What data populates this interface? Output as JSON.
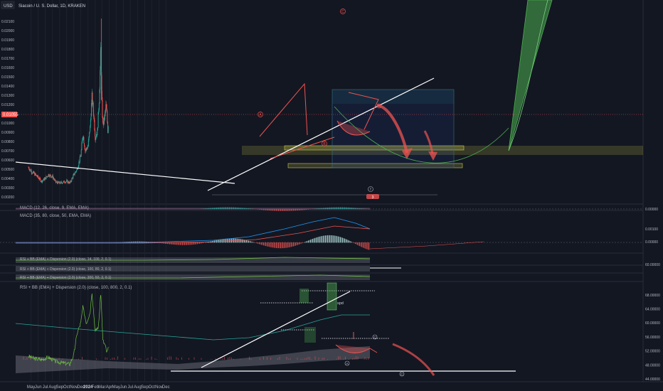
{
  "header": {
    "title": "Siacoin / U. S. Dollar, 1D, KRAKEN",
    "currency_badge": "USD"
  },
  "colors": {
    "background": "#131722",
    "up": "#26a69a",
    "down": "#ef5350",
    "trendline": "#ffffff",
    "zone": "#e0e04a",
    "projection": "#4caf50",
    "rsi": "#6fbf3f",
    "band": "#787b86"
  },
  "price_pane": {
    "current_price_badge": "0.01055",
    "wave_labels": [
      "A",
      "B",
      "C"
    ],
    "circle_labels": [
      "A",
      "C",
      "B",
      "C"
    ],
    "indicator_badges": [
      "f",
      "3"
    ]
  },
  "indicators": {
    "macd1_label": "MACD (12, 26, close, 9, EMA, EMA)",
    "macd2_label": "MACD (35, 80, close, 50, EMA, EMA)",
    "rsi1_label": "RSI + BB (EMA) + Dispersion (2.0) (close, 14, 100, 2, 0.1)",
    "rsi2_label": "RSI + BB (EMA) + Dispersion (2.0) (close, 100, 80, 2, 0.1)",
    "rsi3_label": "RSI + BB (EMA) + Dispersion (2.0) (close, 200, 50, 2, 0.1)",
    "rsi4_label": "RSI + BB (EMA) + Dispersion (2.0) (close, 100, 800, 2, 0.1)",
    "spd_label": "spd"
  },
  "chart_data": [
    {
      "type": "candlestick",
      "title": "Siacoin / U. S. Dollar, 1D, KRAKEN",
      "y_ticks": [
        "0.02100",
        "0.02000",
        "0.01900",
        "0.01800",
        "0.01700",
        "0.01600",
        "0.01500",
        "0.01400",
        "0.01300",
        "0.01200",
        "0.01100",
        "0.01000",
        "0.00900",
        "0.00800",
        "0.00700",
        "0.00600",
        "0.00500",
        "0.00400",
        "0.00300",
        "0.00200"
      ],
      "x_ticks": [
        "May",
        "Jun",
        "Jul",
        "Aug",
        "Sep",
        "Oct",
        "Nov",
        "Dec",
        "2024",
        "Feb",
        "Mar",
        "Apr",
        "May",
        "Jun",
        "Jul",
        "Aug",
        "Sep",
        "Oct",
        "Nov",
        "Dec"
      ],
      "x_ticks_bold": [
        "2024"
      ],
      "ylim": [
        0.002,
        0.022
      ],
      "price_path": [
        [
          "2023-04-20",
          0.0052
        ],
        [
          "2023-05-01",
          0.0048
        ],
        [
          "2023-05-15",
          0.0045
        ],
        [
          "2023-06-01",
          0.0041
        ],
        [
          "2023-06-15",
          0.0037
        ],
        [
          "2023-07-01",
          0.004
        ],
        [
          "2023-07-15",
          0.0044
        ],
        [
          "2023-08-01",
          0.0042
        ],
        [
          "2023-08-15",
          0.0036
        ],
        [
          "2023-09-01",
          0.0035
        ],
        [
          "2023-09-15",
          0.0036
        ],
        [
          "2023-10-01",
          0.0037
        ],
        [
          "2023-10-15",
          0.0035
        ],
        [
          "2023-11-01",
          0.0044
        ],
        [
          "2023-11-15",
          0.005
        ],
        [
          "2023-12-01",
          0.0065
        ],
        [
          "2023-12-10",
          0.0088
        ],
        [
          "2023-12-20",
          0.007
        ],
        [
          "2024-01-01",
          0.0075
        ],
        [
          "2024-01-10",
          0.0095
        ],
        [
          "2024-01-18",
          0.0128
        ],
        [
          "2024-01-25",
          0.011
        ],
        [
          "2024-02-01",
          0.0085
        ],
        [
          "2024-02-10",
          0.009
        ],
        [
          "2024-02-18",
          0.0125
        ],
        [
          "2024-02-25",
          0.018
        ],
        [
          "2024-03-01",
          0.012
        ],
        [
          "2024-03-05",
          0.0098
        ],
        [
          "2024-03-12",
          0.0105
        ],
        [
          "2024-03-18",
          0.0118
        ],
        [
          "2024-03-22",
          0.011
        ],
        [
          "2024-03-26",
          0.0092
        ],
        [
          "2024-03-30",
          0.0105
        ]
      ],
      "high_spike": [
        "2024-02-27",
        0.0213
      ],
      "horizontal_zones": [
        {
          "name": "support-zone-upper",
          "from": 0.0069,
          "to": 0.0072
        },
        {
          "name": "support-zone-lower",
          "from": 0.0051,
          "to": 0.0053
        }
      ],
      "projection_curve_note": "green parabolic projection to new highs"
    },
    {
      "type": "line",
      "title": "MACD (12, 26, close, 9, EMA, EMA)",
      "y_ticks": [
        "0.00000"
      ]
    },
    {
      "type": "line",
      "title": "MACD (35, 80, close, 50, EMA, EMA)",
      "y_ticks": [
        "0.00100",
        "0.00000"
      ]
    },
    {
      "type": "line",
      "title": "RSI + BB (EMA) + Dispersion (2.0) (close, 100, 800, 2, 0.1)",
      "y_ticks": [
        "68.00000",
        "64.00000",
        "60.00000",
        "56.00000",
        "52.00000",
        "48.00000",
        "44.00000"
      ],
      "ylim": [
        44,
        70
      ],
      "rsi_path": [
        [
          "2023-04-20",
          50.5
        ],
        [
          "2023-05-15",
          49.8
        ],
        [
          "2023-06-15",
          49.5
        ],
        [
          "2023-07-15",
          50.2
        ],
        [
          "2023-08-15",
          49.0
        ],
        [
          "2023-09-15",
          48.6
        ],
        [
          "2023-10-15",
          48.2
        ],
        [
          "2023-11-01",
          51.0
        ],
        [
          "2023-11-15",
          57.0
        ],
        [
          "2023-12-01",
          60.0
        ],
        [
          "2023-12-10",
          64.5
        ],
        [
          "2023-12-25",
          60.0
        ],
        [
          "2024-01-10",
          63.0
        ],
        [
          "2024-01-18",
          69.0
        ],
        [
          "2024-02-01",
          57.5
        ],
        [
          "2024-02-15",
          59.0
        ],
        [
          "2024-02-25",
          68.5
        ],
        [
          "2024-03-05",
          55.0
        ],
        [
          "2024-03-15",
          53.5
        ],
        [
          "2024-03-22",
          51.5
        ],
        [
          "2024-03-30",
          53.0
        ]
      ],
      "extra_right_ticks": [
        "60.00000"
      ]
    }
  ]
}
